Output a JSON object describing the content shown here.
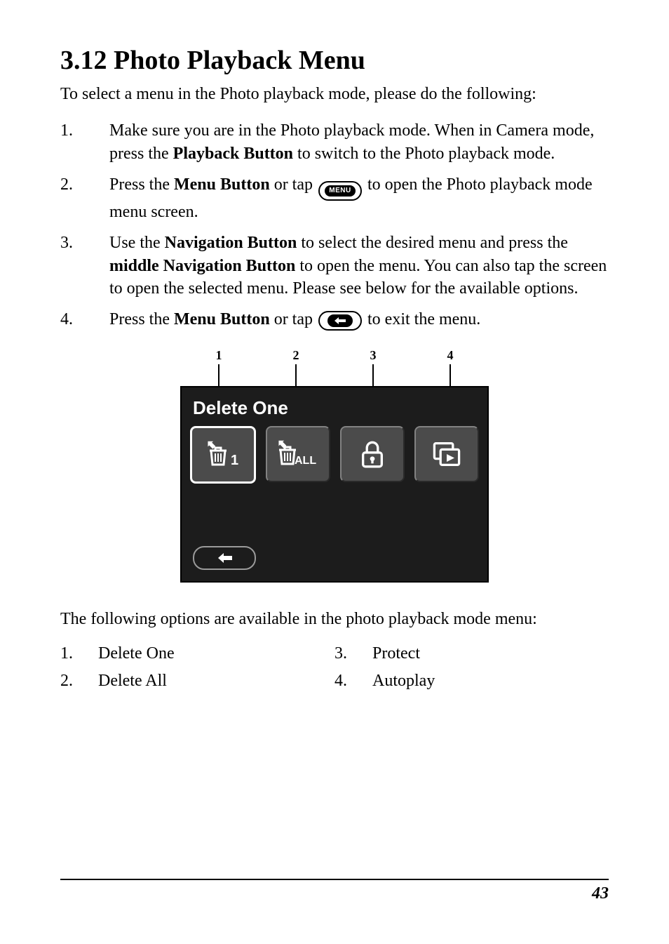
{
  "heading": "3.12 Photo Playback Menu",
  "intro": "To select a menu in the Photo playback mode, please do the following:",
  "steps": [
    {
      "num": "1.",
      "seg": [
        {
          "t": "Make sure you are in the Photo playback mode. When in Camera mode, press the "
        },
        {
          "t": "Playback Button",
          "b": true
        },
        {
          "t": " to switch to the Photo playback mode."
        }
      ]
    },
    {
      "num": "2.",
      "seg": [
        {
          "t": "Press the "
        },
        {
          "t": "Menu Button",
          "b": true
        },
        {
          "t": " or tap "
        },
        {
          "icon": "menu"
        },
        {
          "t": " to open the Photo playback mode menu screen."
        }
      ]
    },
    {
      "num": "3.",
      "seg": [
        {
          "t": "Use the "
        },
        {
          "t": "Navigation Button",
          "b": true
        },
        {
          "t": " to select the desired menu and press the "
        },
        {
          "t": "middle Navigation Button",
          "b": true
        },
        {
          "t": " to open the menu. You can also tap the screen to open the selected menu. Please see below for the available options."
        }
      ]
    },
    {
      "num": "4.",
      "seg": [
        {
          "t": "Press the "
        },
        {
          "t": "Menu Button",
          "b": true
        },
        {
          "t": " or tap "
        },
        {
          "icon": "back"
        },
        {
          "t": " to exit the menu."
        }
      ]
    }
  ],
  "screenshot": {
    "callouts": [
      "1",
      "2",
      "3",
      "4"
    ],
    "title": "Delete One",
    "icons": [
      "delete-one",
      "delete-all",
      "protect",
      "autoplay"
    ]
  },
  "after": "The following options are available in the photo playback mode menu:",
  "options": [
    {
      "n": "1.",
      "label": "Delete One"
    },
    {
      "n": "2.",
      "label": "Delete All"
    },
    {
      "n": "3.",
      "label": "Protect"
    },
    {
      "n": "4.",
      "label": "Autoplay"
    }
  ],
  "icon_labels": {
    "menu": "MENU"
  },
  "page_number": "43"
}
